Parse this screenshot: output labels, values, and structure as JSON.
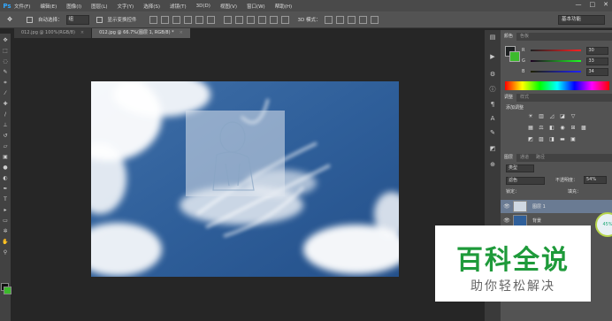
{
  "menubar": {
    "logo": "Ps",
    "items": [
      "文件(F)",
      "编辑(E)",
      "图像(I)",
      "图层(L)",
      "文字(Y)",
      "选择(S)",
      "滤镜(T)",
      "3D(D)",
      "视图(V)",
      "窗口(W)",
      "帮助(H)"
    ],
    "window_buttons": [
      "—",
      "□",
      "✕"
    ]
  },
  "options": {
    "auto_select_label": "自动选择：",
    "auto_select_value": "组",
    "show_transform_label": "显示变换控件",
    "mode_label": "3D 模式：",
    "workspace": "基本功能"
  },
  "tabs": [
    {
      "label": "012.jpg @ 100%(RGB/8)",
      "close": "×"
    },
    {
      "label": "012.jpg @ 66.7%(图层 1, RGB/8) *",
      "close": "×"
    }
  ],
  "color_panel": {
    "tabs": [
      "颜色",
      "色板"
    ],
    "channels": [
      {
        "label": "R",
        "value": "30"
      },
      {
        "label": "G",
        "value": "33"
      },
      {
        "label": "B",
        "value": "34"
      }
    ],
    "fg_color": "#1e2122",
    "bg_color": "#3cba2c"
  },
  "adjust_panel": {
    "tabs": [
      "调整",
      "样式"
    ],
    "heading": "添加调整"
  },
  "layers_panel": {
    "tabs": [
      "图层",
      "通道",
      "路径"
    ],
    "kind": "类型",
    "blend_mode": "滤色",
    "opacity_label": "不透明度：",
    "opacity_value": "54%",
    "lock_label": "锁定：",
    "fill_label": "填充：",
    "layers": [
      {
        "name": "图层 1"
      },
      {
        "name": "背景"
      }
    ]
  },
  "badge": "45%",
  "watermark": {
    "title": "百科全说",
    "subtitle": "助你轻松解决"
  }
}
